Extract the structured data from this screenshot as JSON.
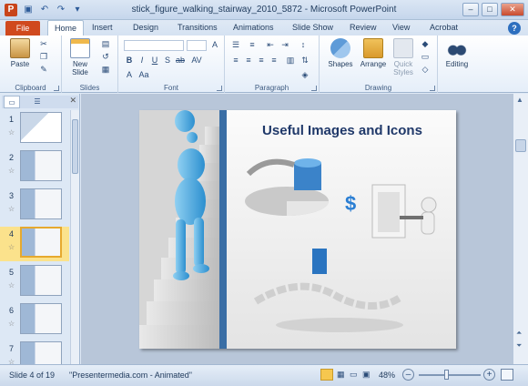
{
  "window": {
    "title": "stick_figure_walking_stairway_2010_5872 - Microsoft PowerPoint",
    "app_letter": "P"
  },
  "tabs": [
    "File",
    "Home",
    "Insert",
    "Design",
    "Transitions",
    "Animations",
    "Slide Show",
    "Review",
    "View",
    "Acrobat"
  ],
  "active_tab": "Home",
  "ribbon": {
    "clipboard": {
      "label": "Clipboard",
      "paste": "Paste"
    },
    "slides": {
      "label": "Slides",
      "new_slide": "New Slide"
    },
    "font": {
      "label": "Font"
    },
    "paragraph": {
      "label": "Paragraph"
    },
    "drawing": {
      "label": "Drawing",
      "shapes": "Shapes",
      "arrange": "Arrange",
      "quick_styles": "Quick Styles"
    },
    "editing": {
      "label": "Editing"
    }
  },
  "thumbnails": {
    "numbers": [
      "1",
      "2",
      "3",
      "4",
      "5",
      "6",
      "7"
    ],
    "selected": "4"
  },
  "slide": {
    "title": "Useful Images and Icons"
  },
  "status": {
    "slide_info": "Slide 4 of 19",
    "theme": "\"Presentermedia.com - Animated\"",
    "zoom": "48%"
  },
  "colors": {
    "file_tab": "#d0491e",
    "accent": "#2d6fbf",
    "title_text": "#1f3869",
    "selected_thumb": "#fbe28c"
  }
}
